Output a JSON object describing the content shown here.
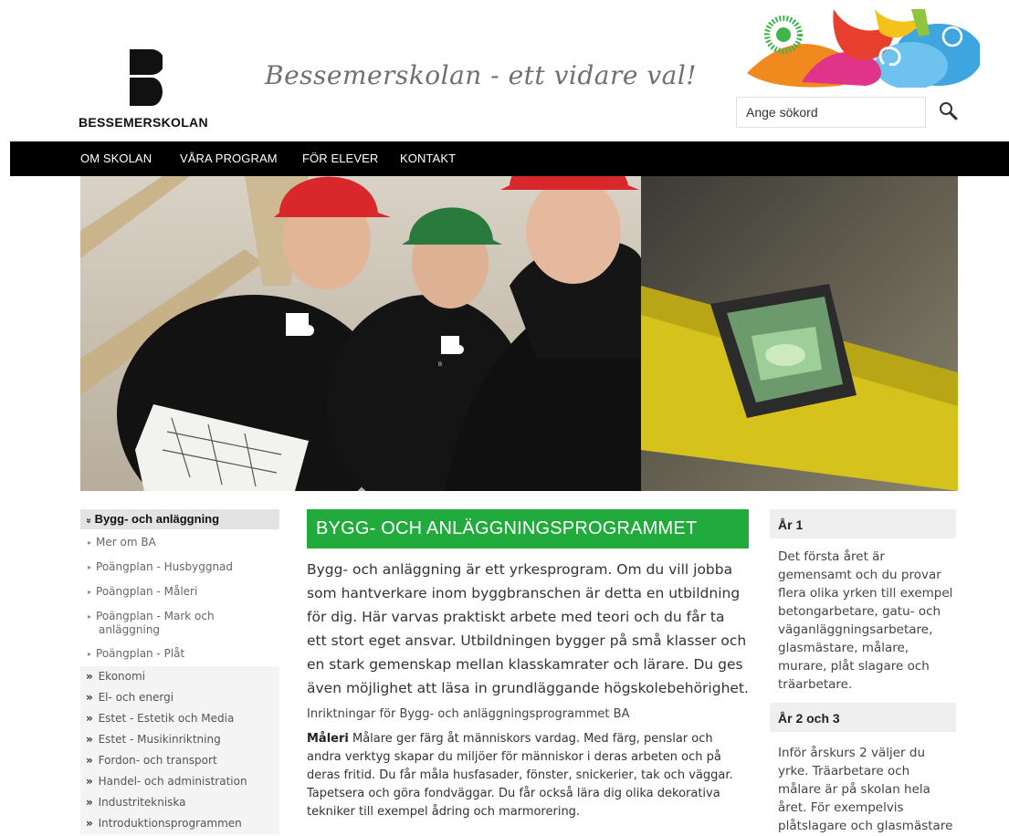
{
  "header": {
    "logo_text": "BESSEMERSKOLAN",
    "tagline": "Bessemerskolan - ett vidare val!",
    "search_placeholder": "Ange sökord"
  },
  "nav": {
    "items": [
      "OM SKOLAN",
      "VÅRA PROGRAM",
      "FÖR ELEVER",
      "KONTAKT"
    ]
  },
  "hero": {
    "jacket_logo_text": "B"
  },
  "sidebar": {
    "active_label": "Bygg- och anläggning",
    "active_marker": "»",
    "sub_marker": "▸",
    "subitems": [
      "Mer om BA",
      "Poängplan - Husbyggnad",
      "Poängplan - Måleri",
      "Poängplan - Mark och anläggning",
      "Poängplan - Plåt"
    ],
    "cat_marker": "»",
    "categories": [
      "Ekonomi",
      "El- och energi",
      "Estet - Estetik och Media",
      "Estet - Musikinriktning",
      "Fordon- och transport",
      "Handel- och administration",
      "Industritekniska",
      "Introduktionsprogrammen"
    ]
  },
  "main": {
    "title": "BYGG- OCH ANLÄGGNINGSPROGRAMMET",
    "intro": "Bygg- och anläggning är ett yrkesprogram. Om du vill jobba som hantverkare inom byggbranschen är detta en utbildning för dig. Här varvas praktiskt arbete med teori och du får ta ett stort eget ansvar. Utbildningen bygger på små klasser och en stark gemenskap mellan klasskamrater och lärare. Du ges även möjlighet att läsa in grundläggande högskolebehörighet.",
    "subhead": "Inriktningar för Bygg- och anläggningsprogrammet BA",
    "para_bold": "Måleri",
    "para_text": " Målare ger färg åt människors vardag. Med färg, penslar och andra verktyg skapar du miljöer för människor i deras arbeten och på deras fritid. Du får måla husfasader, fönster, snickerier, tak och väggar. Tapetsera och göra fondväggar. Du får också lära dig olika dekorativa tekniker till exempel ådring och marmorering."
  },
  "right": {
    "sections": [
      {
        "heading": "År 1",
        "text": "Det första året är gemensamt och du provar flera olika yrken till exempel betongarbetare, gatu- och väganläggningsarbetare, glasmästare, målare, murare, plåt slagare och träarbetare."
      },
      {
        "heading": "År 2 och 3",
        "text": "Inför årskurs 2 väljer du yrke. Träarbetare och målare är på skolan hela året. För exempelvis plåtslagare och glasmästare"
      }
    ]
  },
  "colors": {
    "accent_green": "#22ab3d",
    "nav_bg": "#000000",
    "sidebar_active_bg": "#e3e3e3"
  }
}
